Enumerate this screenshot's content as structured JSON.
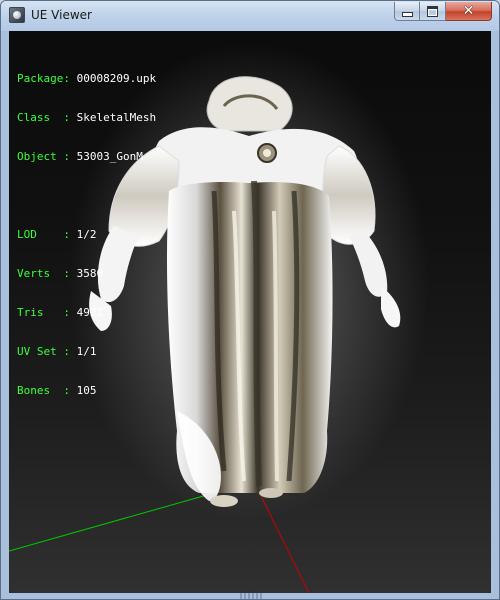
{
  "window": {
    "title": "UE Viewer",
    "controls": {
      "minimize": "minimize",
      "maximize": "maximize",
      "close": "✕"
    }
  },
  "info": {
    "package_label": "Package: ",
    "package_value": "00008209.upk",
    "class_label": "Class  : ",
    "class_value": "SkeletalMesh",
    "object_label": "Object : ",
    "object_value": "53003_GonM",
    "lod_label": "LOD    : ",
    "lod_value": "1/2",
    "verts_label": "Verts  : ",
    "verts_value": "3580",
    "tris_label": "Tris   : ",
    "tris_value": "4922",
    "uvset_label": "UV Set : ",
    "uvset_value": "1/1",
    "bones_label": "Bones  : ",
    "bones_value": "105"
  },
  "colors": {
    "label": "#3cff3c",
    "value": "#ffffff",
    "axis_x": "#00c800",
    "axis_y": "#c80000"
  }
}
